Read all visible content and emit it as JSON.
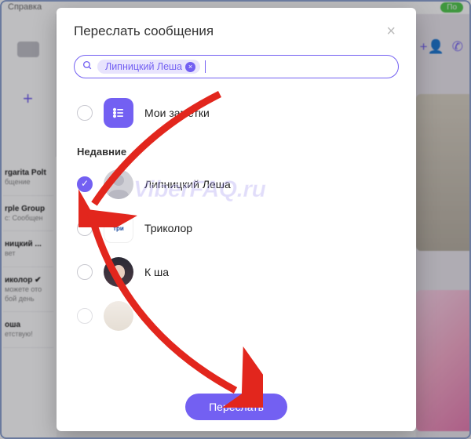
{
  "bg": {
    "help": "Справка",
    "pill": "По",
    "chats": [
      {
        "name": "rgarita Polt",
        "msg": "бщение"
      },
      {
        "name": "rple Group",
        "msg": "с: Сообщен"
      },
      {
        "name": "ницкий ...",
        "msg": "вет"
      },
      {
        "name": "иколор ✔",
        "msg": "можете ото  бой день"
      },
      {
        "name": "оша",
        "msg": "етствую!"
      }
    ]
  },
  "modal": {
    "title": "Переслать сообщения",
    "chip": "Липницкий Леша",
    "notes_label": "Мои заметки",
    "recent_label": "Недавние",
    "contacts": [
      {
        "name": "Липницкий Леша",
        "checked": true,
        "avatar": "person"
      },
      {
        "name": "Триколор",
        "checked": false,
        "avatar": "tricolor"
      },
      {
        "name": "К    ша",
        "checked": false,
        "avatar": "photo1"
      },
      {
        "name": "",
        "checked": false,
        "avatar": "photo2"
      }
    ],
    "forward_button": "Переслать"
  },
  "watermark": "ViberFAQ.ru"
}
